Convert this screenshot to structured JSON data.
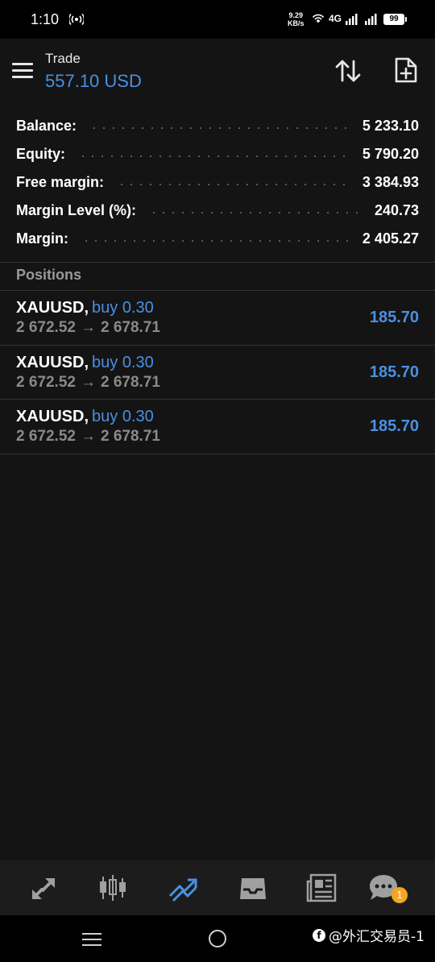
{
  "status_bar": {
    "time": "1:10",
    "speed_value": "9.29",
    "speed_unit": "KB/s",
    "network": "4G",
    "battery": "99"
  },
  "header": {
    "title": "Trade",
    "balance": "557.10 USD",
    "icons": [
      "menu-icon",
      "sort-icon",
      "new-order-icon"
    ]
  },
  "summary": [
    {
      "label": "Balance:",
      "value": "5 233.10"
    },
    {
      "label": "Equity:",
      "value": "5 790.20"
    },
    {
      "label": "Free margin:",
      "value": "3 384.93"
    },
    {
      "label": "Margin Level (%):",
      "value": "240.73"
    },
    {
      "label": "Margin:",
      "value": "2 405.27"
    }
  ],
  "positions_title": "Positions",
  "positions": [
    {
      "symbol": "XAUUSD,",
      "side": "buy 0.30",
      "open_price": "2 672.52",
      "arrow": "→",
      "current_price": "2 678.71",
      "profit": "185.70"
    },
    {
      "symbol": "XAUUSD,",
      "side": "buy 0.30",
      "open_price": "2 672.52",
      "arrow": "→",
      "current_price": "2 678.71",
      "profit": "185.70"
    },
    {
      "symbol": "XAUUSD,",
      "side": "buy 0.30",
      "open_price": "2 672.52",
      "arrow": "→",
      "current_price": "2 678.71",
      "profit": "185.70"
    }
  ],
  "bottom_nav": {
    "items": [
      "quotes-icon",
      "chart-icon",
      "trade-icon",
      "history-icon",
      "news-icon",
      "chat-icon"
    ],
    "active": "trade-icon",
    "chat_badge": "1"
  },
  "watermark": "@外汇交易员-1",
  "colors": {
    "accent": "#4a90e2",
    "background": "#141414",
    "badge": "#f5a623"
  }
}
